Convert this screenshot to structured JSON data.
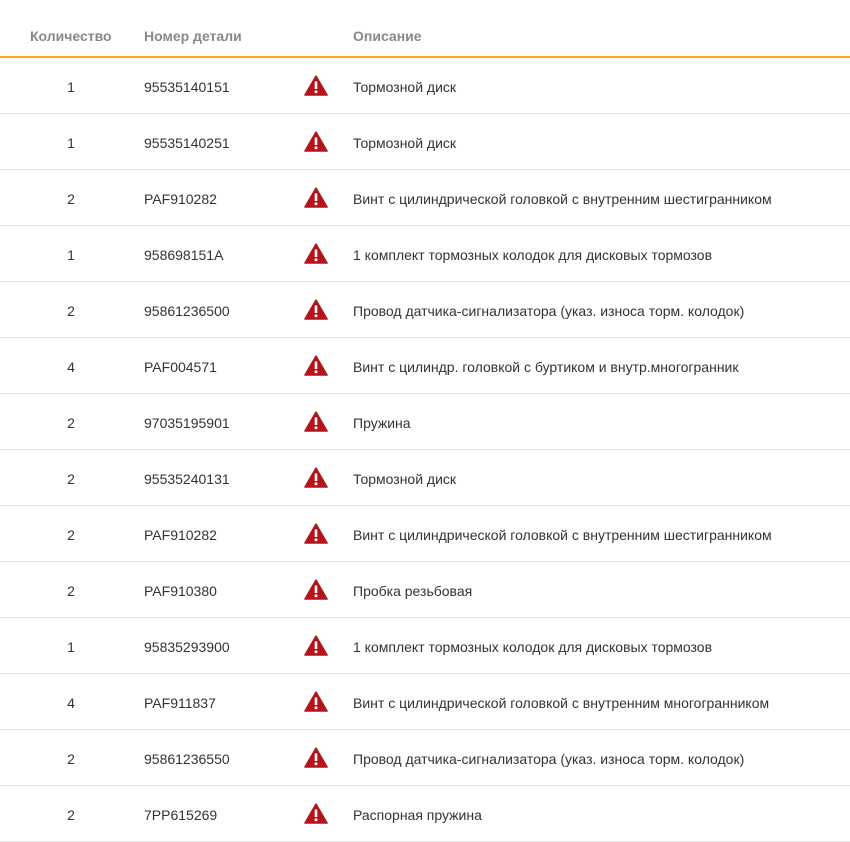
{
  "header": {
    "quantity": "Количество",
    "part_number": "Номер детали",
    "description": "Описание"
  },
  "icon": "warning-triangle-icon",
  "colors": {
    "accent": "#f5b21a",
    "warning": "#b3141c"
  },
  "rows": [
    {
      "qty": "1",
      "part": "95535140151",
      "desc": "Тормозной диск"
    },
    {
      "qty": "1",
      "part": "95535140251",
      "desc": "Тормозной диск"
    },
    {
      "qty": "2",
      "part": "PAF910282",
      "desc": "Винт с цилиндрической головкой с внутренним шестигранником"
    },
    {
      "qty": "1",
      "part": "958698151A",
      "desc": "1 комплект тормозных колодок для дисковых тормозов"
    },
    {
      "qty": "2",
      "part": "95861236500",
      "desc": "Провод датчика-сигнализатора (указ. износа торм. колодок)"
    },
    {
      "qty": "4",
      "part": "PAF004571",
      "desc": "Винт с цилиндр. головкой с буртиком и внутр.многогранник"
    },
    {
      "qty": "2",
      "part": "97035195901",
      "desc": "Пружина"
    },
    {
      "qty": "2",
      "part": "95535240131",
      "desc": "Тормозной диск"
    },
    {
      "qty": "2",
      "part": "PAF910282",
      "desc": "Винт с цилиндрической головкой с внутренним шестигранником"
    },
    {
      "qty": "2",
      "part": "PAF910380",
      "desc": "Пробка резьбовая"
    },
    {
      "qty": "1",
      "part": "95835293900",
      "desc": "1 комплект тормозных колодок для дисковых тормозов"
    },
    {
      "qty": "4",
      "part": "PAF911837",
      "desc": "Винт с цилиндрической головкой с внутренним многогранником"
    },
    {
      "qty": "2",
      "part": "95861236550",
      "desc": "Провод датчика-сигнализатора (указ. износа торм. колодок)"
    },
    {
      "qty": "2",
      "part": "7PP615269",
      "desc": "Распорная пружина"
    }
  ]
}
